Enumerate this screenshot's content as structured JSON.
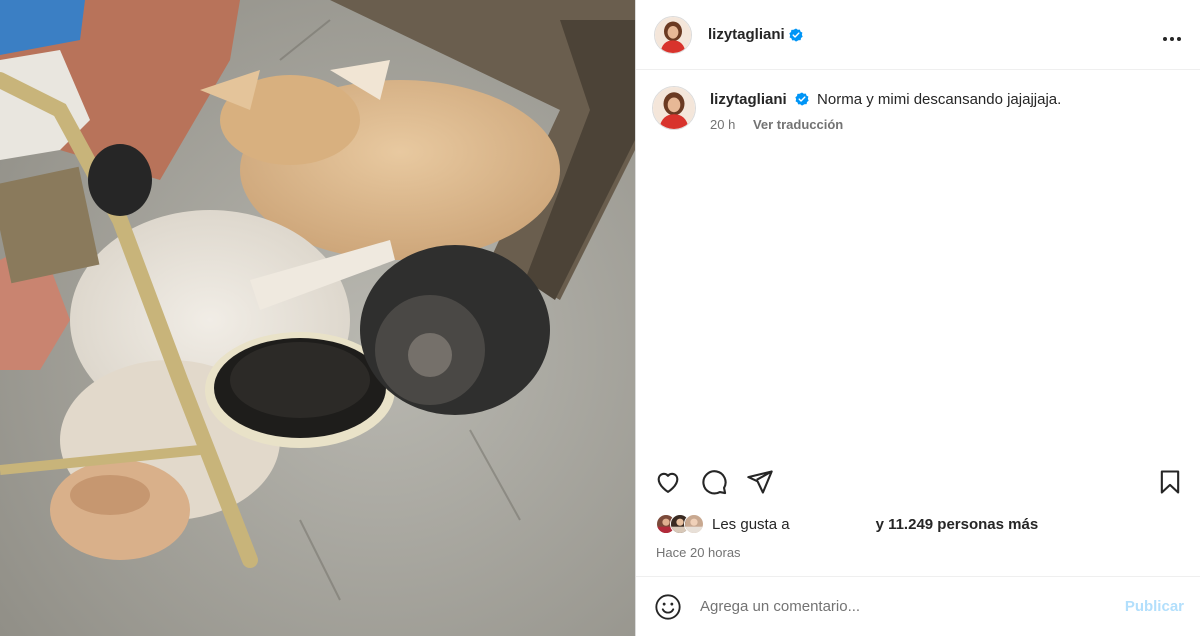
{
  "post": {
    "username": "lizytagliani",
    "verified": true,
    "more_icon": "more-horizontal-icon"
  },
  "caption": {
    "username": "lizytagliani",
    "text": "Norma y mimi descansando jajajjaja.",
    "age": "20 h",
    "translate_label": "Ver traducción"
  },
  "actions": {
    "icons": [
      "heart-icon",
      "comment-icon",
      "share-icon",
      "bookmark-icon"
    ]
  },
  "likes": {
    "prefix": "Les gusta a",
    "suffix": "y 11.249 personas más"
  },
  "timestamp": "Hace 20 horas",
  "comment": {
    "placeholder": "Agrega un comentario...",
    "publish_label": "Publicar"
  },
  "colors": {
    "verified_blue": "#0095f6",
    "publish_disabled": "#b2dffc",
    "avatar_red": "#d8332c"
  }
}
